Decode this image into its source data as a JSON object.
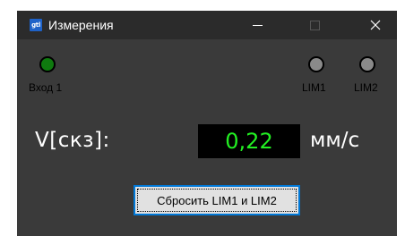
{
  "window": {
    "title": "Измерения",
    "app_icon_text": "gtl",
    "controls": {
      "minimize": "minimize-icon",
      "maximize": "maximize-icon",
      "close": "close-icon"
    }
  },
  "indicators": [
    {
      "label": "Вход 1",
      "state": "on",
      "color": "#0f7a0f"
    },
    {
      "label": "LIM1",
      "state": "off",
      "color": "#8a8a8a"
    },
    {
      "label": "LIM2",
      "state": "off",
      "color": "#8a8a8a"
    }
  ],
  "measurement": {
    "label": "V[скз]:",
    "value": "0,22",
    "unit": "мм/с",
    "value_color": "#22ee22"
  },
  "reset_button": {
    "label": "Сбросить LIM1 и LIM2"
  }
}
